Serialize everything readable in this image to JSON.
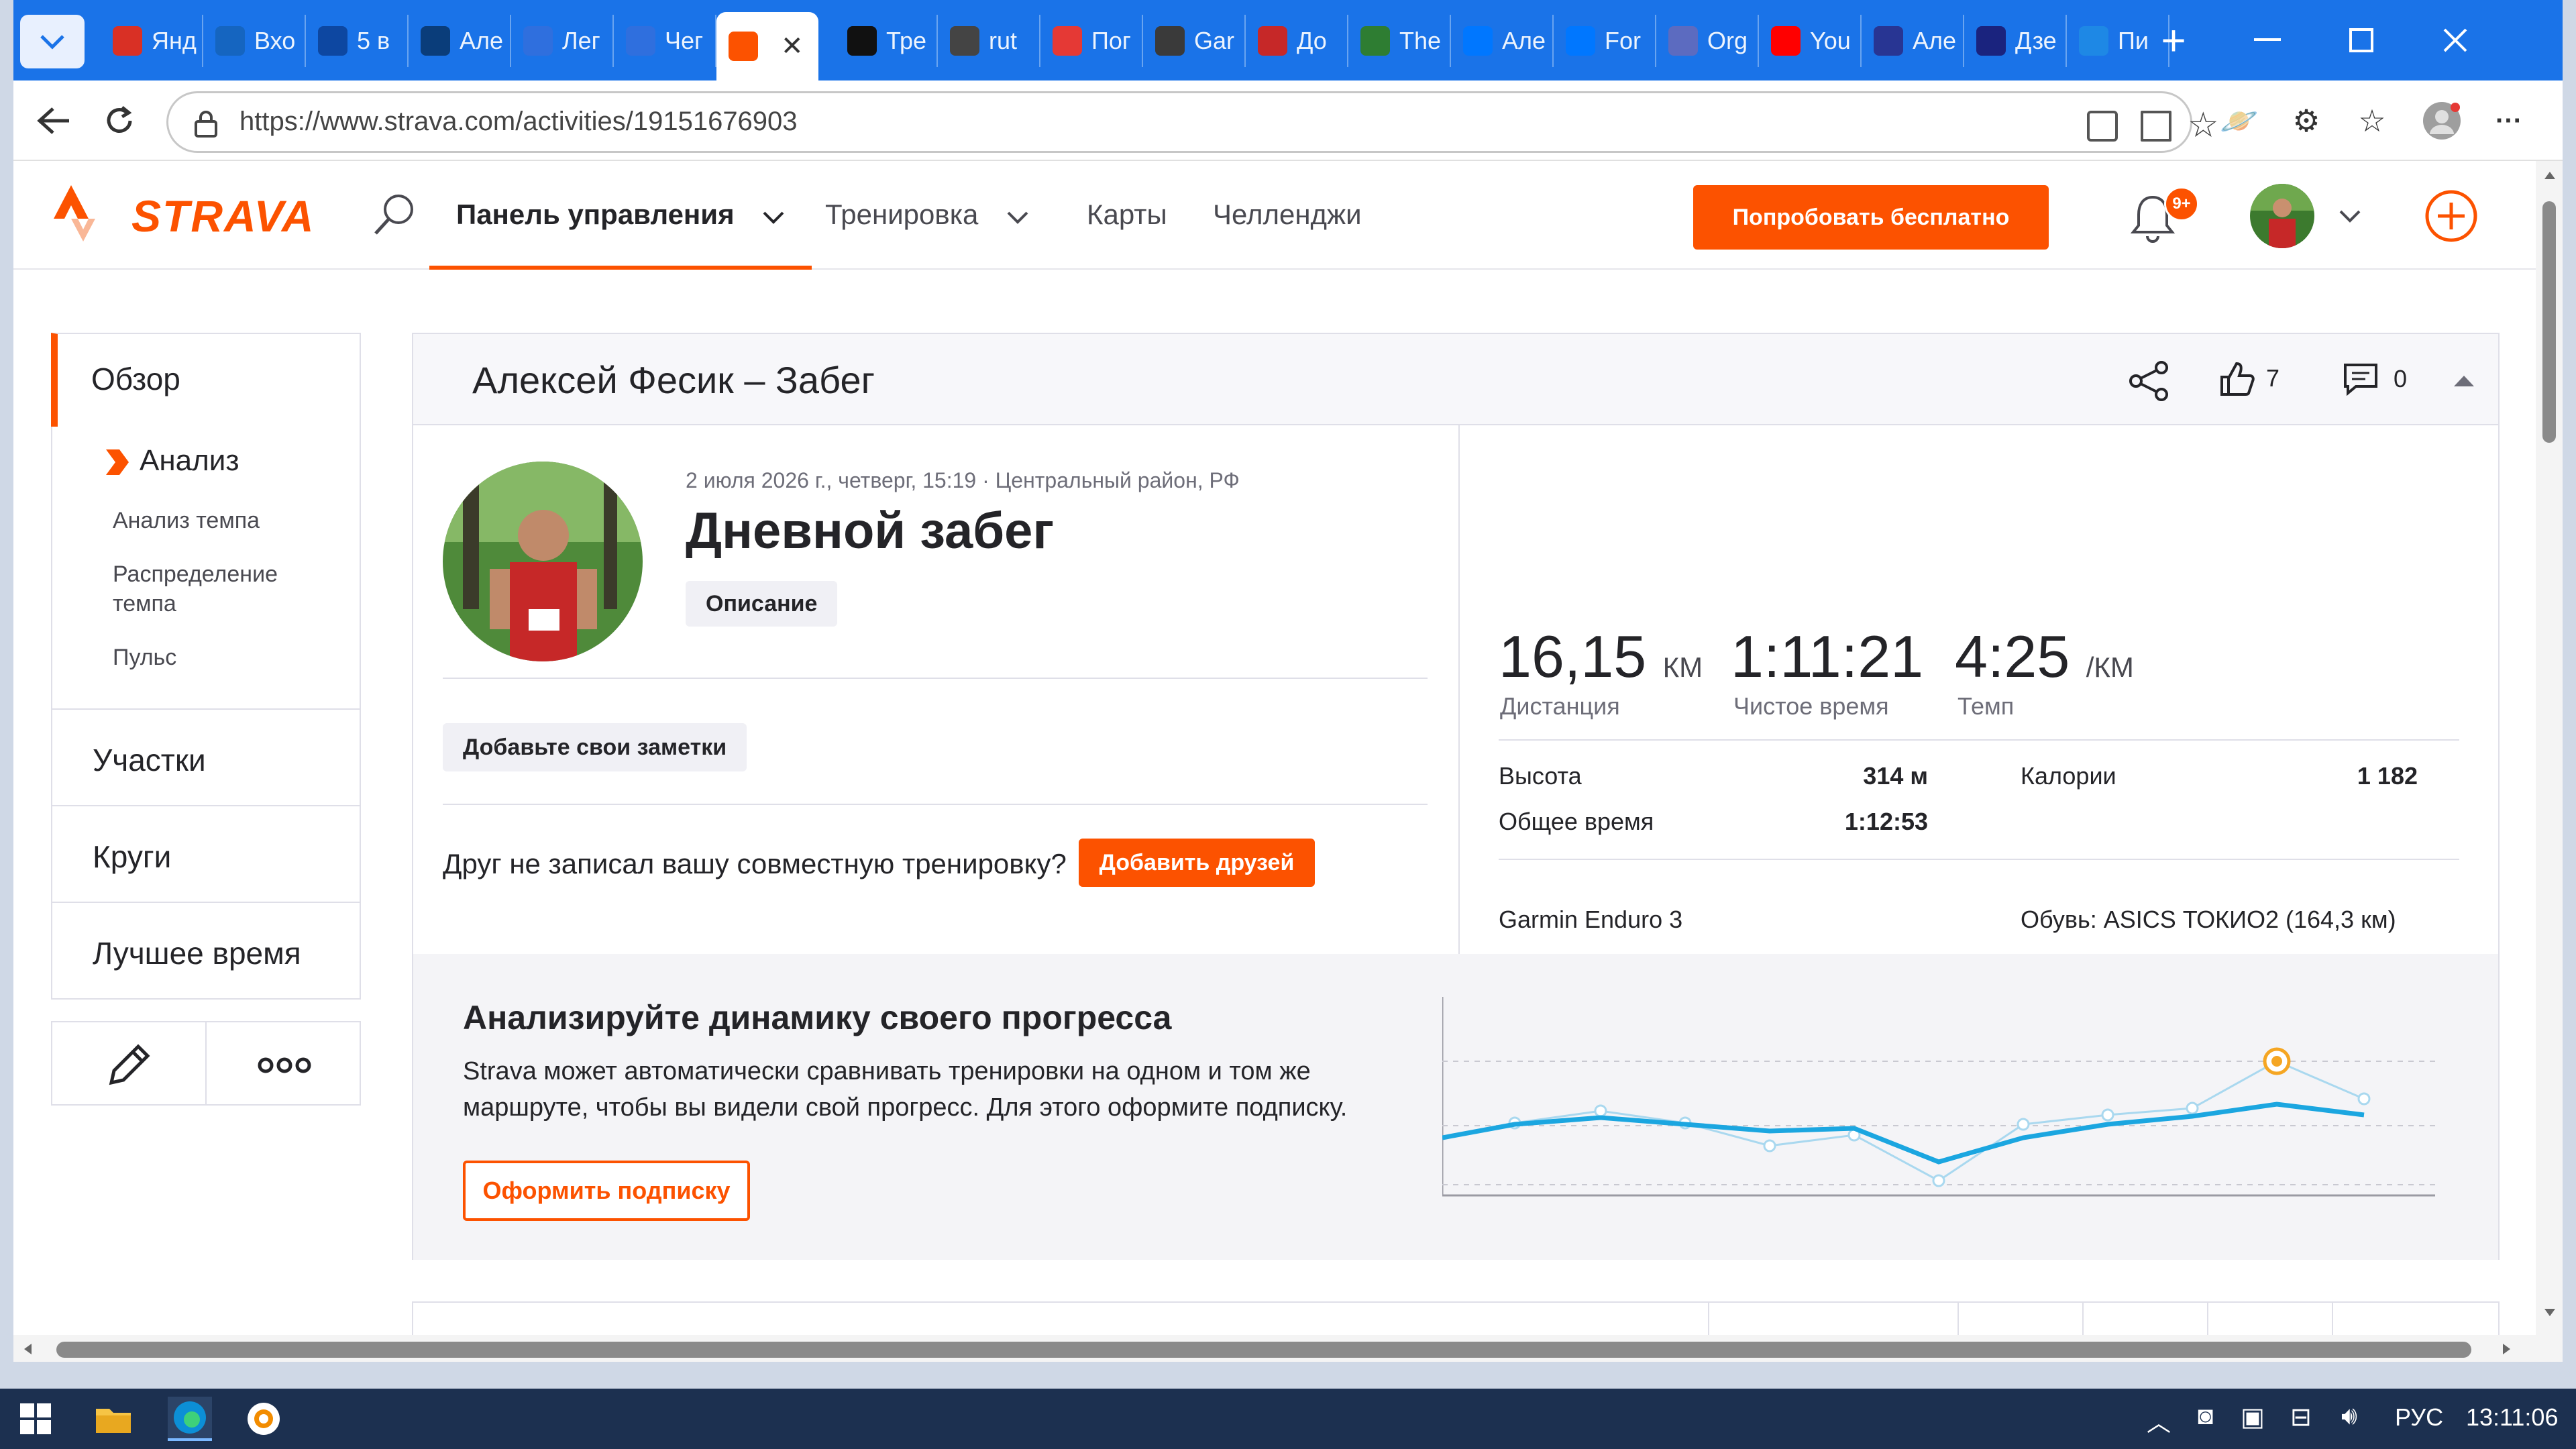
{
  "browser": {
    "tabs": [
      {
        "label": "Янд",
        "icon_color": "#d93025"
      },
      {
        "label": "Вхо",
        "icon_color": "#1565c0"
      },
      {
        "label": "5 в",
        "icon_color": "#0d47a1"
      },
      {
        "label": "Але",
        "icon_color": "#0a3d7a"
      },
      {
        "label": "Лег",
        "icon_color": "#2f6fde"
      },
      {
        "label": "Чег",
        "icon_color": "#2f6fde"
      },
      {
        "label": "",
        "icon_color": "#fc5200"
      },
      {
        "label": "Тре",
        "icon_color": "#111111"
      },
      {
        "label": "rut",
        "icon_color": "#444444"
      },
      {
        "label": "Пог",
        "icon_color": "#e53935"
      },
      {
        "label": "Gar",
        "icon_color": "#3a3a3a"
      },
      {
        "label": "До",
        "icon_color": "#c62828"
      },
      {
        "label": "The",
        "icon_color": "#2e7d32"
      },
      {
        "label": "Але",
        "icon_color": "#0077ff"
      },
      {
        "label": "For",
        "icon_color": "#0077ff"
      },
      {
        "label": "Org",
        "icon_color": "#5c6bc0"
      },
      {
        "label": "You",
        "icon_color": "#ff0000"
      },
      {
        "label": "Але",
        "icon_color": "#283593"
      },
      {
        "label": "Дзе",
        "icon_color": "#1a237e"
      },
      {
        "label": "Пи",
        "icon_color": "#1e88e5"
      }
    ],
    "url": "https://www.strava.com/activities/19151676903"
  },
  "strava": {
    "logo": "STRAVA",
    "nav": {
      "dashboard": "Панель управления",
      "training": "Тренировка",
      "maps": "Карты",
      "challenges": "Челленджи"
    },
    "try_button": "Попробовать бесплатно",
    "notifications_badge": "9+",
    "accent": "#fc5200"
  },
  "sidebar": {
    "overview": "Обзор",
    "analysis": "Анализ",
    "sub": [
      "Анализ темпа",
      "Распределение темпа",
      "Пульс"
    ],
    "segments": "Участки",
    "laps": "Круги",
    "best_efforts": "Лучшее время"
  },
  "activity": {
    "header_title": "Алексей Фесик – Забег",
    "kudos_count": "7",
    "comments_count": "0",
    "meta": "2 июля 2026 г., четверг, 15:19 · Центральный район, РФ",
    "title": "Дневной забег",
    "description_button": "Описание",
    "add_notes": "Добавьте свои заметки",
    "friend_prompt": "Друг не записал вашу совместную тренировку?",
    "add_friends": "Добавить друзей",
    "stats": {
      "distance_value": "16,15",
      "distance_unit": "КМ",
      "distance_label": "Дистанция",
      "moving_time_value": "1:11:21",
      "moving_time_label": "Чистое время",
      "pace_value": "4:25",
      "pace_unit": "/КМ",
      "pace_label": "Темп"
    },
    "details": {
      "elevation_label": "Высота",
      "elevation_value": "314 м",
      "calories_label": "Калории",
      "calories_value": "1 182",
      "elapsed_label": "Общее время",
      "elapsed_value": "1:12:53",
      "device": "Garmin Enduro 3",
      "shoes": "Обувь: ASICS ТОКИО2 (164,3 км)"
    }
  },
  "promo": {
    "title": "Анализируйте динамику своего прогресса",
    "text": "Strava может автоматически сравнивать тренировки на одном и том же маршруте, чтобы вы видели свой прогресс. Для этого оформите подписку.",
    "button": "Оформить подписку"
  },
  "taskbar": {
    "lang": "РУС",
    "time": "13:11:06"
  }
}
